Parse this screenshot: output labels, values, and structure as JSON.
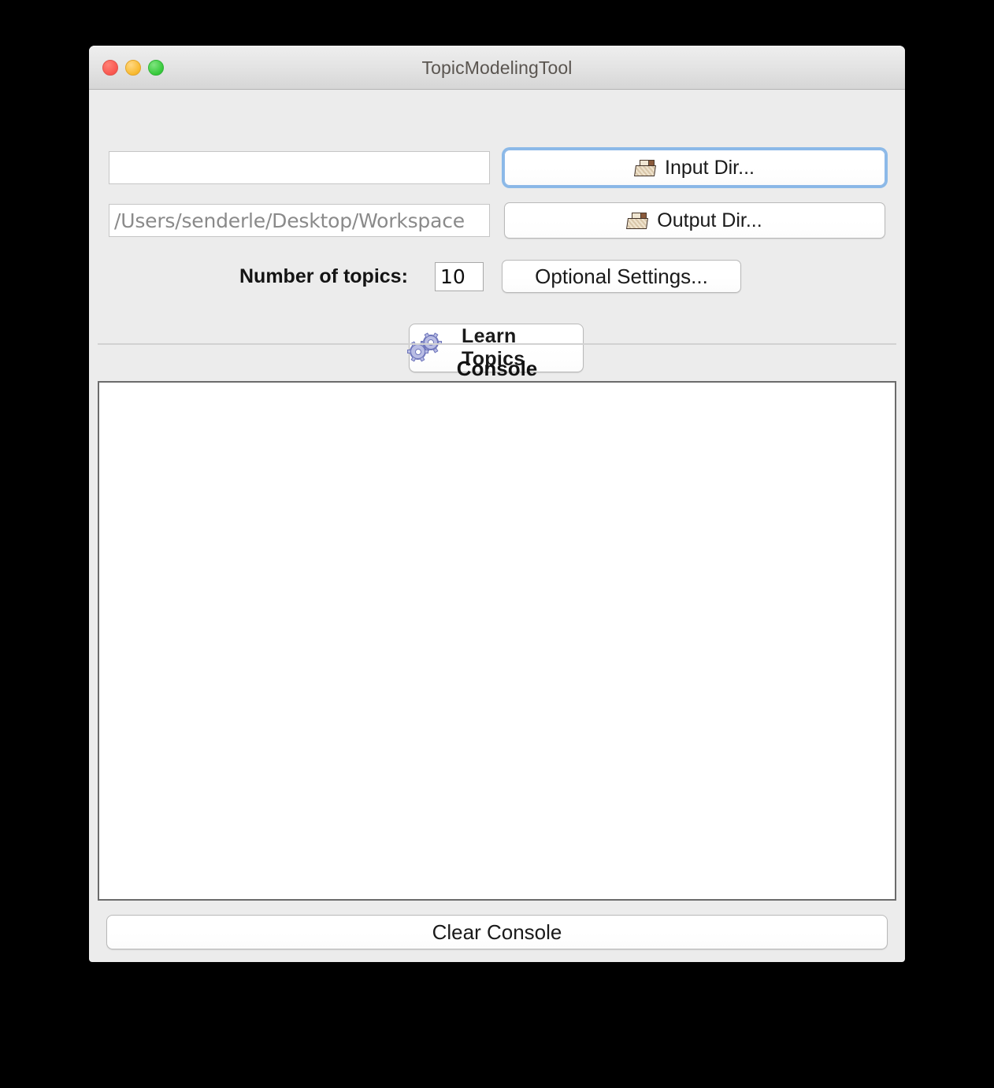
{
  "window": {
    "title": "TopicModelingTool",
    "traffic_lights": [
      {
        "name": "close",
        "color": "#f9564f"
      },
      {
        "name": "minimize",
        "color": "#f8b92e"
      },
      {
        "name": "zoom",
        "color": "#36c93a"
      }
    ]
  },
  "form": {
    "input_dir": {
      "value": "",
      "placeholder": "",
      "button_label": "Input Dir...",
      "button_icon": "folder-icon",
      "focused": true
    },
    "output_dir": {
      "value": "/Users/senderle/Desktop/Workspace",
      "placeholder": "",
      "button_label": "Output Dir...",
      "button_icon": "folder-icon",
      "focused": false
    },
    "topics": {
      "label": "Number of topics:",
      "value": "10"
    },
    "optional_settings_label": "Optional Settings...",
    "learn_topics_label": "Learn Topics",
    "learn_topics_icon": "gears-icon"
  },
  "console": {
    "title": "Console",
    "text": "",
    "clear_label": "Clear Console"
  },
  "colors": {
    "window_background": "#ececec",
    "titlebar_top": "#eeeeee",
    "titlebar_bottom": "#d6d6d6",
    "title_text": "#5a5550",
    "focus_ring": "#7ab0e8",
    "console_border": "#6b6b6b",
    "separator": "#d2d2d2",
    "placeholder_text": "#8a8a8a",
    "gear_fill": "#b9bde4",
    "gear_stroke": "#6f76bb",
    "folder_fill": "#efe3cd",
    "folder_stroke": "#3f3026"
  }
}
